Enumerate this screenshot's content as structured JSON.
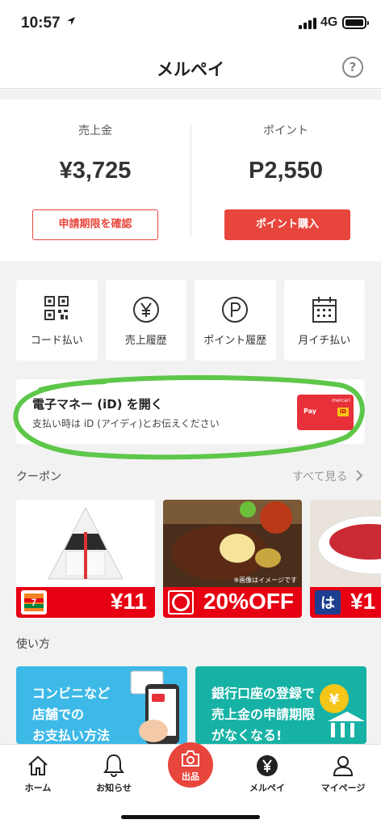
{
  "status": {
    "time": "10:57",
    "network": "4G"
  },
  "header": {
    "title": "メルペイ",
    "help": "?"
  },
  "balance": {
    "sales_label": "売上金",
    "sales_amount": "¥3,725",
    "sales_button": "申請期限を確認",
    "points_label": "ポイント",
    "points_amount": "P2,550",
    "points_button": "ポイント購入"
  },
  "quick_actions": [
    {
      "label": "コード払い",
      "icon": "qr-code-icon"
    },
    {
      "label": "売上履歴",
      "icon": "yen-circle-icon"
    },
    {
      "label": "ポイント履歴",
      "icon": "p-circle-icon"
    },
    {
      "label": "月イチ払い",
      "icon": "calendar-icon"
    }
  ],
  "id_banner": {
    "title": "電子マネー (iD) を開く",
    "subtitle": "支払い時は iD (アイディ)とお伝えください",
    "card_brand": "mercari",
    "card_pay": "Pay",
    "card_id": "iD"
  },
  "coupons": {
    "section_title": "クーポン",
    "see_all": "すべて見る",
    "items": [
      {
        "value": "¥11",
        "brand": "7-ELEVEn"
      },
      {
        "value": "20%OFF",
        "brand": "ガスト",
        "note": "※画像はイメージです"
      },
      {
        "value": "¥1",
        "brand": "はま寿司"
      }
    ]
  },
  "howto": {
    "section_title": "使い方",
    "cards": [
      {
        "lines": [
          "コンビニなど",
          "店舗での",
          "お支払い方法"
        ]
      },
      {
        "lines": [
          "銀行口座の登録で",
          "売上金の申請期限",
          "がなくなる!"
        ]
      }
    ]
  },
  "tabbar": {
    "items": [
      {
        "label": "ホーム"
      },
      {
        "label": "お知らせ"
      },
      {
        "label": "出品"
      },
      {
        "label": "メルペイ"
      },
      {
        "label": "マイページ"
      }
    ]
  },
  "colors": {
    "accent": "#e8453c",
    "highlight_circle": "#5ec74a"
  }
}
